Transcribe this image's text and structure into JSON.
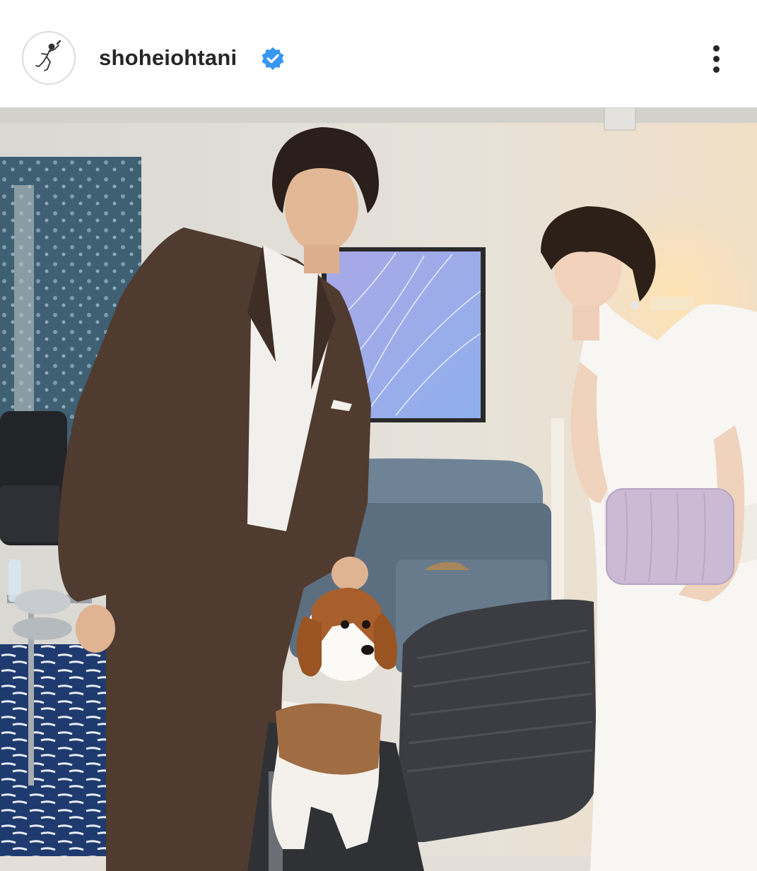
{
  "post": {
    "username": "shoheiohtani",
    "verified": true,
    "avatar_icon": "baseball-player-sketch-icon",
    "more_icon": "more-options-vertical-icon"
  },
  "photo": {
    "subject": "photo"
  },
  "colors": {
    "verified_badge": "#3897f0",
    "text": "#262626"
  }
}
